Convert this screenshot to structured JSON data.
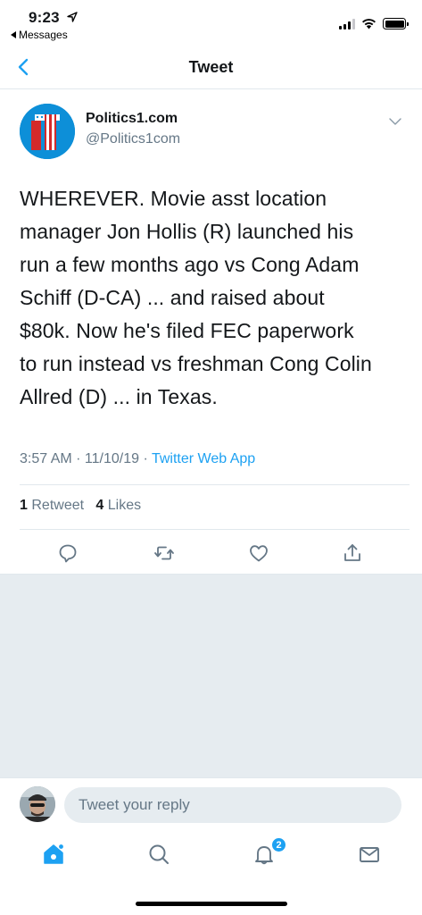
{
  "status_bar": {
    "time": "9:23",
    "back_app": "Messages"
  },
  "header": {
    "title": "Tweet"
  },
  "tweet": {
    "author_name": "Politics1.com",
    "author_handle": "@Politics1com",
    "lines": [
      "WHEREVER. Movie asst location",
      "manager Jon Hollis (R) launched his",
      "run a few months ago vs Cong Adam",
      "Schiff (D-CA) ... and raised about",
      "$80k. Now he's filed FEC paperwork",
      "to run instead vs freshman Cong Colin",
      "Allred (D) ... in Texas."
    ],
    "timestamp": "3:57 AM · 11/10/19 · ",
    "source": "Twitter Web App",
    "retweet_count": "1",
    "retweet_label": "Retweet",
    "like_count": "4",
    "like_label": "Likes"
  },
  "reply": {
    "placeholder": "Tweet your reply"
  },
  "tab_bar": {
    "notification_badge": "2"
  },
  "icons": {
    "back": "chevron-left-icon",
    "menu": "chevron-down-icon",
    "reply": "reply-icon",
    "retweet": "retweet-icon",
    "like": "heart-icon",
    "share": "share-icon",
    "home": "home-icon",
    "search": "search-icon",
    "notifications": "bell-icon",
    "messages": "mail-icon"
  },
  "colors": {
    "accent": "#1da1f2",
    "secondary_text": "#657786",
    "divider": "#e1e8ed",
    "background_gray": "#e6ecf0"
  }
}
